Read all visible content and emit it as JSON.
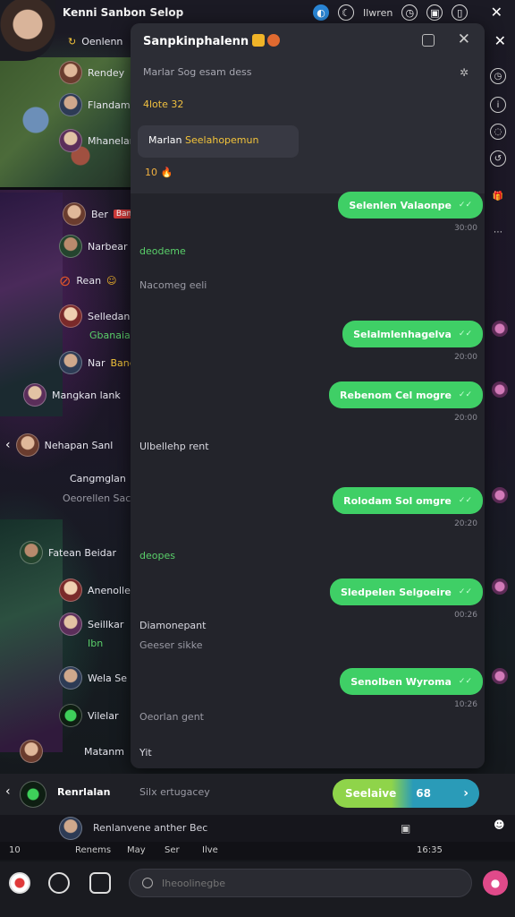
{
  "topbar": {
    "title": "Kenni Sanbon Selop",
    "status": "Ilwren",
    "close": "✕"
  },
  "left_list": {
    "rows": [
      {
        "name": "Oenlenn",
        "badge": ""
      },
      {
        "name": "Rendey",
        "badge": ""
      },
      {
        "name": "Flandam",
        "badge": ""
      },
      {
        "name": "Mhanelan",
        "badge": ""
      },
      {
        "name": "Ber",
        "badge": "Ban"
      },
      {
        "name": "Narbear",
        "badge": ""
      },
      {
        "name": "Rean",
        "badge": ""
      },
      {
        "name": "Selledan",
        "badge": "Gbanaiar"
      },
      {
        "name": "Nar",
        "badge": "Bane"
      },
      {
        "name": "Mangkan lank",
        "badge": ""
      },
      {
        "name": "Nehapan Sanl",
        "badge": ""
      },
      {
        "name": "Cangmglan",
        "badge": ""
      },
      {
        "name": "Oeorellen Sac",
        "badge": ""
      },
      {
        "name": "Fatean Beidar",
        "badge": ""
      },
      {
        "name": "Anenolle",
        "badge": ""
      },
      {
        "name": "Seillkar",
        "badge": "Ibn"
      },
      {
        "name": "Wela Se",
        "badge": ""
      },
      {
        "name": "Vilelar",
        "badge": ""
      },
      {
        "name": "Matanm",
        "badge": ""
      }
    ]
  },
  "chat": {
    "title": "Sanpkinphalenn",
    "subtitle": "Marlar Sog esam dess",
    "meta": "4lote 32",
    "card_name": "Marlan",
    "card_highlight": "Seelahopemun",
    "count": "10",
    "messages": [
      {
        "dir": "out",
        "text": "Selenlen Valaonpe",
        "time": "30:00"
      },
      {
        "dir": "in",
        "text": "deodeme",
        "style": "green"
      },
      {
        "dir": "in",
        "text": "Nacomeg eeli",
        "style": "muted"
      },
      {
        "dir": "out",
        "text": "Selalmlenhagelva",
        "time": "20:00"
      },
      {
        "dir": "out",
        "text": "Rebenom Cel mogre",
        "time": "20:00"
      },
      {
        "dir": "in",
        "text": "Ulbellehp rent",
        "style": "normal"
      },
      {
        "dir": "out",
        "text": "Rolodam Sol omgre",
        "time": "20:20"
      },
      {
        "dir": "in",
        "text": "deopes",
        "style": "green"
      },
      {
        "dir": "out",
        "text": "Sledpelen Selgoeire",
        "time": "00:26"
      },
      {
        "dir": "in",
        "text": "Diamonepant",
        "style": "normal"
      },
      {
        "dir": "in",
        "text": "Geeser sikke",
        "style": "muted"
      },
      {
        "dir": "out",
        "text": "Senolben Wyroma",
        "time": "10:26"
      },
      {
        "dir": "in",
        "text": "Oeorlan gent",
        "style": "muted"
      },
      {
        "dir": "in",
        "text": "Yit",
        "style": "normal"
      }
    ]
  },
  "composer": {
    "name": "Renrlalan",
    "hint": "Silx ertugacey",
    "send_label": "Seelaive",
    "send_count": "68"
  },
  "strip": {
    "text": "Renlanvene anther Bec"
  },
  "status_line": {
    "items": [
      "10",
      "Renems",
      "May",
      "Ser",
      "Ilve",
      "16:35"
    ]
  },
  "search": {
    "placeholder": "Iheoolinegbe"
  },
  "colors": {
    "accent_green": "#3fcf66",
    "send_blue": "#2a9bb8",
    "highlight_yellow": "#f3c43a"
  }
}
